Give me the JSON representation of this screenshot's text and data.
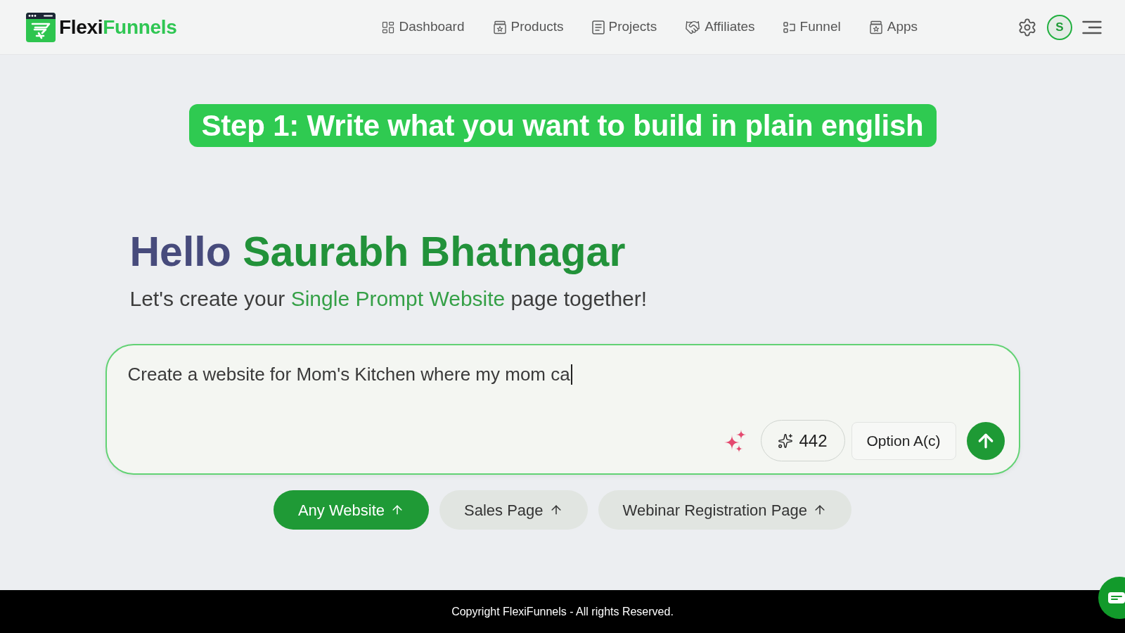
{
  "header": {
    "brand": {
      "first": "Flexi",
      "second": "Funnels"
    },
    "nav": [
      {
        "label": "Dashboard"
      },
      {
        "label": "Products"
      },
      {
        "label": "Projects"
      },
      {
        "label": "Affiliates"
      },
      {
        "label": "Funnel"
      },
      {
        "label": "Apps"
      }
    ],
    "avatar": {
      "initial": "S"
    }
  },
  "banner": {
    "text": "Step 1: Write what you want to build in plain english"
  },
  "greeting": {
    "hello": "Hello",
    "name": "Saurabh Bhatnagar"
  },
  "intro": {
    "before": "Let's create your ",
    "highlight": "Single Prompt Website",
    "after": " page together!"
  },
  "prompt": {
    "value": "Create a website for Mom's Kitchen where my mom ca",
    "credits": "442",
    "model": "Option A(c)"
  },
  "templates": [
    {
      "label": "Any Website",
      "selected": true
    },
    {
      "label": "Sales Page",
      "selected": false
    },
    {
      "label": "Webinar Registration Page",
      "selected": false
    }
  ],
  "footer": {
    "copyright": "Copyright FlexiFunnels - All rights Reserved."
  }
}
